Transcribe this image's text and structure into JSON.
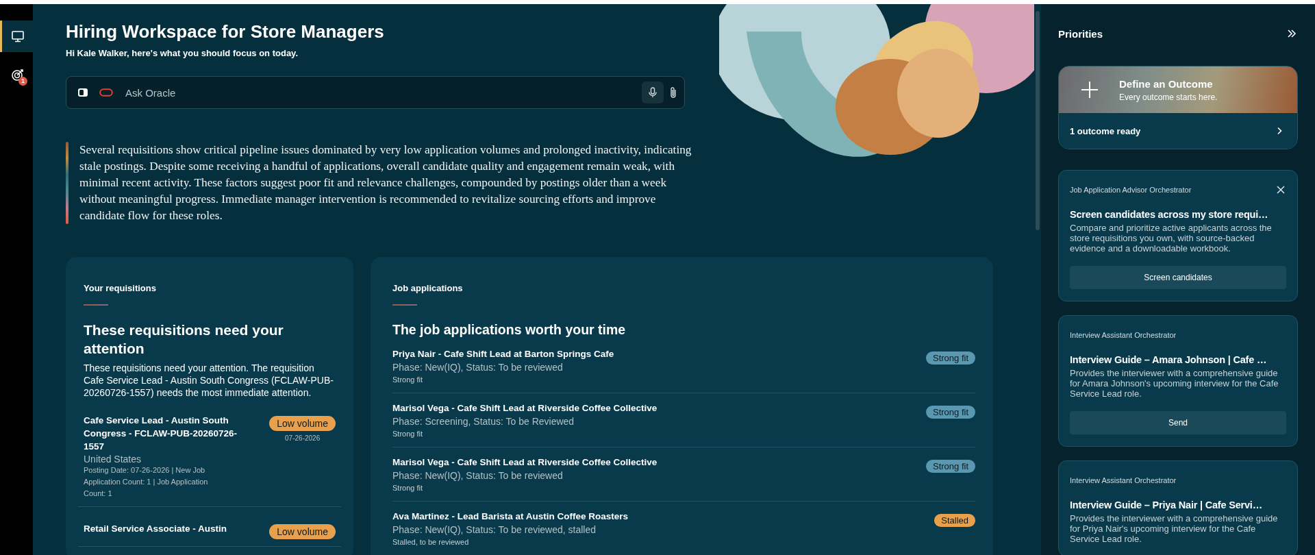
{
  "sidebar": {
    "items": [
      {
        "kind": "monitor",
        "selected": true
      },
      {
        "kind": "target",
        "selected": false,
        "badge": "1"
      }
    ]
  },
  "header": {
    "title": "Hiring Workspace for Store Managers",
    "subtitle": "Hi Kale Walker, here's what you should focus on today."
  },
  "ask": {
    "placeholder": "Ask Oracle"
  },
  "summary": "Several requisitions show critical pipeline issues dominated by very low application volumes and prolonged inactivity, indicating stale postings. Despite some receiving a handful of applications, overall candidate quality and engagement remain weak, with minimal recent activity. These factors suggest poor fit and relevance challenges, compounded by postings older than a week without meaningful progress. Immediate manager intervention is recommended to revitalize sourcing efforts and improve candidate flow for these roles.",
  "requisitions": {
    "label": "Your requisitions",
    "heading": "These requisitions need your attention",
    "description": "These requisitions need your attention. The requisition Cafe Service Lead - Austin South Congress (FCLAW-PUB-20260726-1557) needs the most immediate attention.",
    "items": [
      {
        "title": "Cafe Service Lead - Austin South Congress - FCLAW-PUB-20260726-1557",
        "location": "United States",
        "details": "Posting Date: 07-26-2026 | New Job Application Count: 1 | Job Application Count: 1",
        "badge": {
          "text": "Low volume",
          "kind": "warning"
        },
        "date": "07-26-2026"
      },
      {
        "title": "Retail Service Associate - Austin",
        "badge": {
          "text": "Low volume",
          "kind": "warning"
        }
      }
    ]
  },
  "applications": {
    "label": "Job applications",
    "heading": "The job applications worth your time",
    "items": [
      {
        "title": "Priya Nair - Cafe Shift Lead at Barton Springs Cafe",
        "phase": "Phase: New(IQ), Status: To be reviewed",
        "note": "Strong fit",
        "badge": {
          "text": "Strong fit",
          "kind": "info"
        }
      },
      {
        "title": "Marisol Vega - Cafe Shift Lead at Riverside Coffee Collective",
        "phase": "Phase: Screening, Status: To be Reviewed",
        "note": "Strong fit",
        "badge": {
          "text": "Strong fit",
          "kind": "info"
        }
      },
      {
        "title": "Marisol Vega - Cafe Shift Lead at Riverside Coffee Collective",
        "phase": "Phase: New(IQ), Status: To be reviewed",
        "note": "Strong fit",
        "badge": {
          "text": "Strong fit",
          "kind": "info"
        }
      },
      {
        "title": "Ava Martinez - Lead Barista at Austin Coffee Roasters",
        "phase": "Phase: New(IQ), Status: To be reviewed, stalled",
        "note": "Stalled, to be reviewed",
        "badge": {
          "text": "Stalled",
          "kind": "warning"
        }
      }
    ]
  },
  "priorities": {
    "title": "Priorities",
    "outcome": {
      "title": "Define an Outcome",
      "subtitle": "Every outcome starts here.",
      "ready": "1 outcome ready"
    },
    "cards": [
      {
        "source": "Job Application Advisor Orchestrator",
        "dismissible": true,
        "title": "Screen candidates across my store requi…",
        "description": "Compare and prioritize active applicants across the store requisitions you own, with source-backed evidence and a downloadable workbook.",
        "action": "Screen candidates"
      },
      {
        "source": "Interview Assistant Orchestrator",
        "dismissible": false,
        "title": "Interview Guide – Amara Johnson | Cafe …",
        "description": "Provides the interviewer with a comprehensive guide for Amara Johnson's upcoming interview for the Cafe Service Lead role.",
        "action": "Send"
      },
      {
        "source": "Interview Assistant Orchestrator",
        "dismissible": false,
        "title": "Interview Guide – Priya Nair | Cafe Servi…",
        "description": "Provides the interviewer with a comprehensive guide for Priya Nair's upcoming interview for the Cafe Service Lead role."
      }
    ]
  }
}
